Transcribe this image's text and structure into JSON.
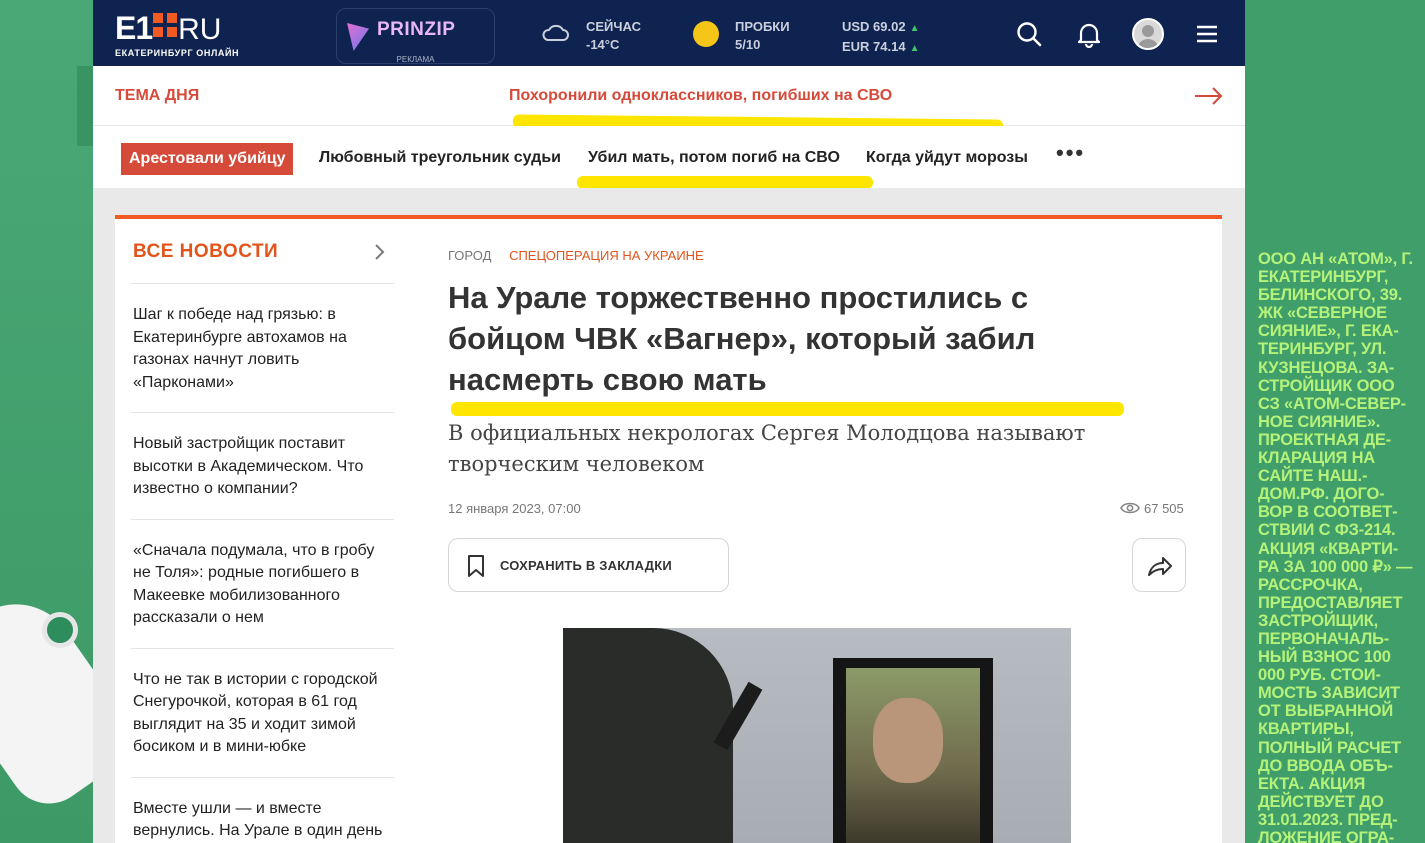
{
  "header": {
    "logo": {
      "main": "E1",
      "domain": "RU",
      "tagline": "ЕКАТЕРИНБУРГ ОНЛАЙН"
    },
    "ad": {
      "brand": "PRINZIP",
      "label": "РЕКЛАМА"
    },
    "weather": {
      "label": "СЕЙЧАС",
      "value": "-14°C",
      "icon": "cloud-icon"
    },
    "traffic": {
      "label": "ПРОБКИ",
      "value": "5/10"
    },
    "currency": {
      "usd": "USD 69.02",
      "eur": "EUR 74.14",
      "trend_icon": "▲"
    },
    "icons": [
      "search-icon",
      "bell-icon",
      "avatar",
      "menu-icon"
    ]
  },
  "theme_of_day": {
    "label": "ТЕМА ДНЯ",
    "link": "Похоронили одноклассников, погибших на СВО",
    "arrow_icon": "arrow-right-icon"
  },
  "tags": [
    "Арестовали убийцу",
    "Любовный треугольник судьи",
    "Убил мать, потом погиб на СВО",
    "Когда уйдут морозы"
  ],
  "tags_more": "•••",
  "all_news": {
    "title": "ВСЕ НОВОСТИ",
    "items": [
      "Шаг к победе над грязью: в Екатеринбурге автохамов на газонах начнут ловить «Парконами»",
      "Новый застройщик поставит высотки в Академическом. Что известно о компании?",
      "«Сначала подумала, что в гробу не Толя»: родные погибшего в Макеевке мобилизованного рассказали о нем",
      "Что не так в истории с городской Снегурочкой, которая в 61 год выглядит на 35 и ходит зимой босиком и в мини-юбке",
      "Вместе ушли — и вместе вернулись. На Урале в один день похоронили двух"
    ]
  },
  "article": {
    "category": "ГОРОД",
    "rubric": "СПЕЦОПЕРАЦИЯ НА УКРАИНЕ",
    "headline": "На Урале торжественно простились с бойцом ЧВК «Вагнер», который забил насмерть свою мать",
    "lead": "В официальных некрологах Сергея Молодцова называют творческим человеком",
    "date": "12 января 2023, 07:00",
    "views": "67 505",
    "bookmark_label": "СОХРАНИТЬ В ЗАКЛАДКИ"
  },
  "promo_text": "ООО АН «АТОМ», г. Екатеринбург, Белинского, 39. ЖК «Северное сияние», г. Ека-теринбург, ул. Кузнецова. За-стройщик ООО СЗ «Атом-Север-ное сияние». Проектная де-кларация на сайте наш.-дом.рф. Дого-вор в соответ-ствии с ФЗ-214. Акция «Кварти-ра за 100 000 ₽» — рассрочка, предоставляет застройщик, первоначаль-ный взнос 100 000 руб. Стои-мость зависит от выбранной квартиры, полный расчет до ввода объ-екта. Акция действует до 31.01.2023. Пред-ложение огра-",
  "colors": {
    "header_bg": "#0f2350",
    "accent_red": "#d64a3a",
    "accent_orange": "#f15a22",
    "highlight": "#ffe600",
    "side_bg": "#3f9e6a",
    "promo_text": "#b5f27a"
  }
}
